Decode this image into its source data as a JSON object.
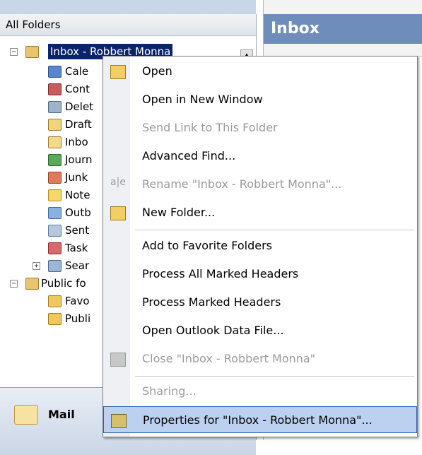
{
  "nav": {
    "header": "All Folders",
    "tree": {
      "root_label": "Inbox - Robbert Monna",
      "items": [
        {
          "label": "Cale",
          "icon": "calendar-icon"
        },
        {
          "label": "Cont",
          "icon": "contacts-icon"
        },
        {
          "label": "Delet",
          "icon": "trash-icon"
        },
        {
          "label": "Draft",
          "icon": "drafts-icon"
        },
        {
          "label": "Inbo",
          "icon": "inbox-icon"
        },
        {
          "label": "Journ",
          "icon": "journal-icon"
        },
        {
          "label": "Junk",
          "icon": "junk-icon"
        },
        {
          "label": "Note",
          "icon": "note-icon"
        },
        {
          "label": "Outb",
          "icon": "outbox-icon"
        },
        {
          "label": "Sent",
          "icon": "sent-icon"
        },
        {
          "label": "Task",
          "icon": "task-icon"
        },
        {
          "label": "Sear",
          "icon": "search-folder-icon"
        }
      ],
      "public_label": "Public fo",
      "public_items": [
        {
          "label": "Favo",
          "icon": "folder-icon"
        },
        {
          "label": "Publi",
          "icon": "folder-icon"
        }
      ]
    },
    "bottom": {
      "mail_label": "Mail"
    }
  },
  "right": {
    "title": "Inbox"
  },
  "context_menu": {
    "items": [
      {
        "label": "Open",
        "disabled": false
      },
      {
        "label": "Open in New Window",
        "disabled": false
      },
      {
        "label": "Send Link to This Folder",
        "disabled": true
      },
      {
        "label": "Advanced Find...",
        "disabled": false
      },
      {
        "label": "Rename \"Inbox - Robbert Monna\"...",
        "disabled": true
      },
      {
        "label": "New Folder...",
        "disabled": false
      },
      {
        "label": "Add to Favorite Folders",
        "disabled": false
      },
      {
        "label": "Process All Marked Headers",
        "disabled": false
      },
      {
        "label": "Process Marked Headers",
        "disabled": false
      },
      {
        "label": "Open Outlook Data File...",
        "disabled": false
      },
      {
        "label": "Close \"Inbox - Robbert Monna\"",
        "disabled": true
      },
      {
        "label": "Sharing...",
        "disabled": true
      },
      {
        "label": "Properties for \"Inbox - Robbert Monna\"...",
        "disabled": false,
        "highlighted": true
      }
    ],
    "colors": {
      "highlight": "#bcd0f0",
      "highlight_border": "#2d5fb3",
      "disabled_text": "#9a9a9a"
    }
  },
  "colors": {
    "selection": "#0a246a",
    "title_bar": "#6f8dbb"
  }
}
